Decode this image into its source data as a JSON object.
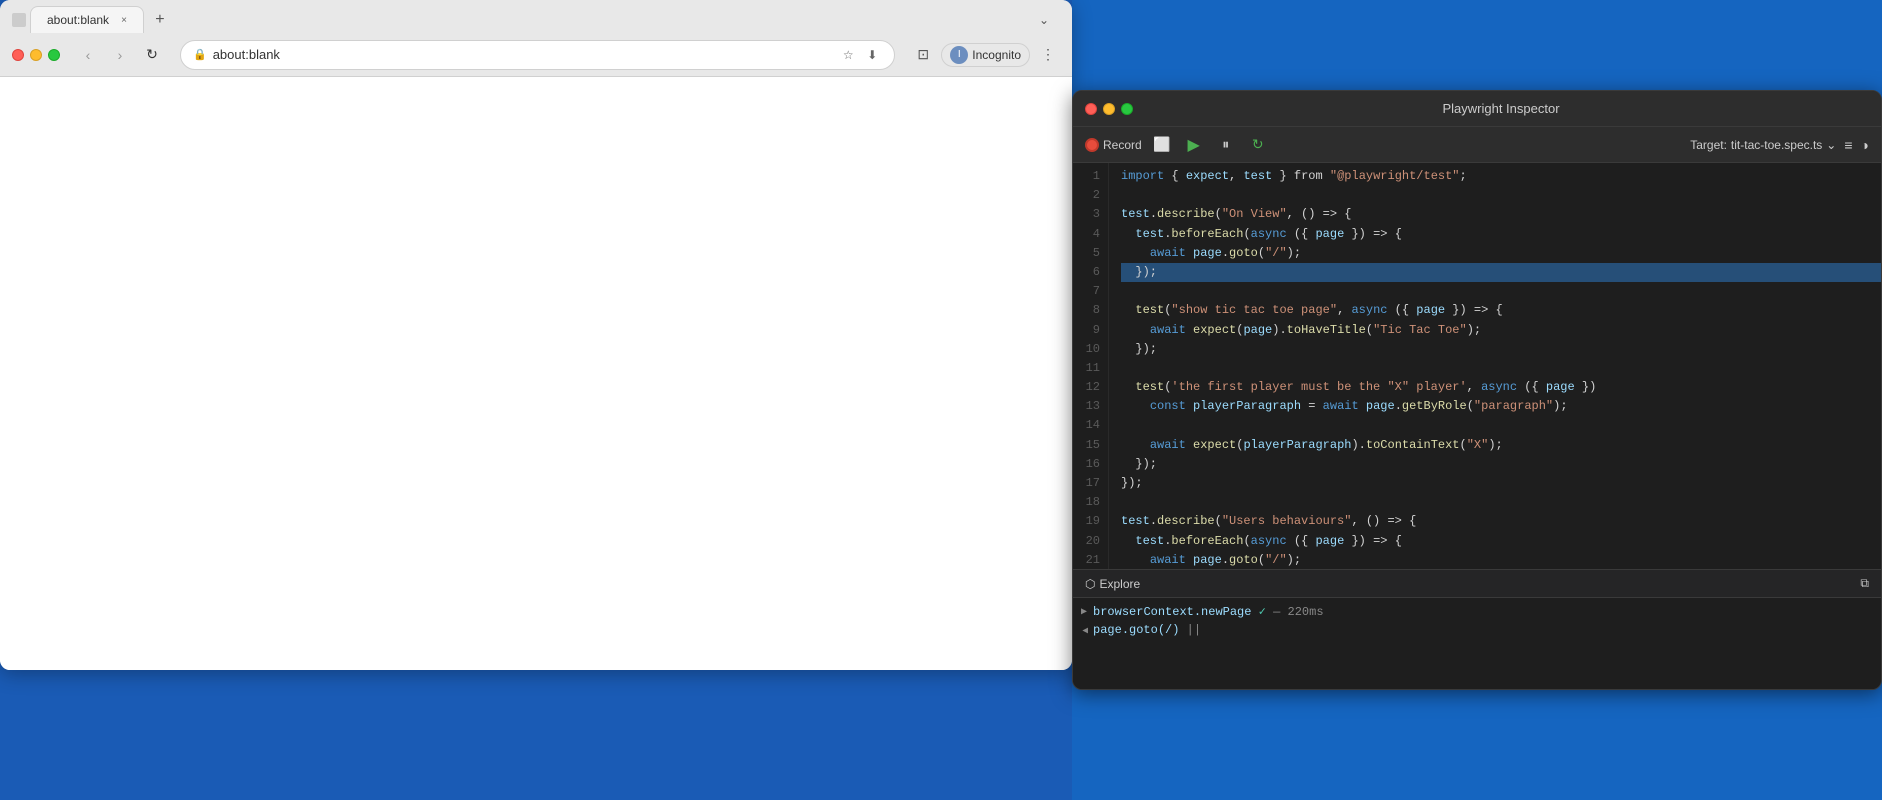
{
  "browser": {
    "tab_title": "about:blank",
    "tab_close": "×",
    "address": "about:blank",
    "new_tab_plus": "+",
    "chevron_down": "⌄",
    "profile_label": "Incognito",
    "nav_back": "‹",
    "nav_forward": "›",
    "nav_reload": "↻"
  },
  "inspector": {
    "title": "Playwright Inspector",
    "record_label": "Record",
    "target_label": "Target:",
    "target_file": "tit-tac-toe.spec.ts",
    "chevron_down": "⌄",
    "lines": [
      {
        "num": 1,
        "text": "import { expect, test } from \"@playwright/test\";",
        "highlight": false
      },
      {
        "num": 2,
        "text": "",
        "highlight": false
      },
      {
        "num": 3,
        "text": "test.describe(\"On View\", () => {",
        "highlight": false
      },
      {
        "num": 4,
        "text": "  test.beforeEach(async ({ page }) => {",
        "highlight": false
      },
      {
        "num": 5,
        "text": "    await page.goto(\"/\");",
        "highlight": false
      },
      {
        "num": 6,
        "text": "  });",
        "highlight": true
      },
      {
        "num": 7,
        "text": "",
        "highlight": false
      },
      {
        "num": 8,
        "text": "  test(\"show tic tac toe page\", async ({ page }) => {",
        "highlight": false
      },
      {
        "num": 9,
        "text": "    await expect(page).toHaveTitle(\"Tic Tac Toe\");",
        "highlight": false
      },
      {
        "num": 10,
        "text": "  });",
        "highlight": false
      },
      {
        "num": 11,
        "text": "",
        "highlight": false
      },
      {
        "num": 12,
        "text": "  test('the first player must be the \"X\" player', async ({ page })",
        "highlight": false
      },
      {
        "num": 13,
        "text": "    const playerParagraph = await page.getByRole(\"paragraph\");",
        "highlight": false
      },
      {
        "num": 14,
        "text": "",
        "highlight": false
      },
      {
        "num": 15,
        "text": "    await expect(playerParagraph).toContainText(\"X\");",
        "highlight": false
      },
      {
        "num": 16,
        "text": "  });",
        "highlight": false
      },
      {
        "num": 17,
        "text": "});",
        "highlight": false
      },
      {
        "num": 18,
        "text": "",
        "highlight": false
      },
      {
        "num": 19,
        "text": "test.describe(\"Users behaviours\", () => {",
        "highlight": false
      },
      {
        "num": 20,
        "text": "  test.beforeEach(async ({ page }) => {",
        "highlight": false
      },
      {
        "num": 21,
        "text": "    await page.goto(\"/\");",
        "highlight": false
      }
    ],
    "explore_label": "Explore",
    "log_entries": [
      {
        "chevron": ">",
        "open": false,
        "text": "browserContext.newPage ✓ — 220ms"
      },
      {
        "chevron": "∨",
        "open": true,
        "text": "page.goto(/) ||"
      }
    ]
  }
}
